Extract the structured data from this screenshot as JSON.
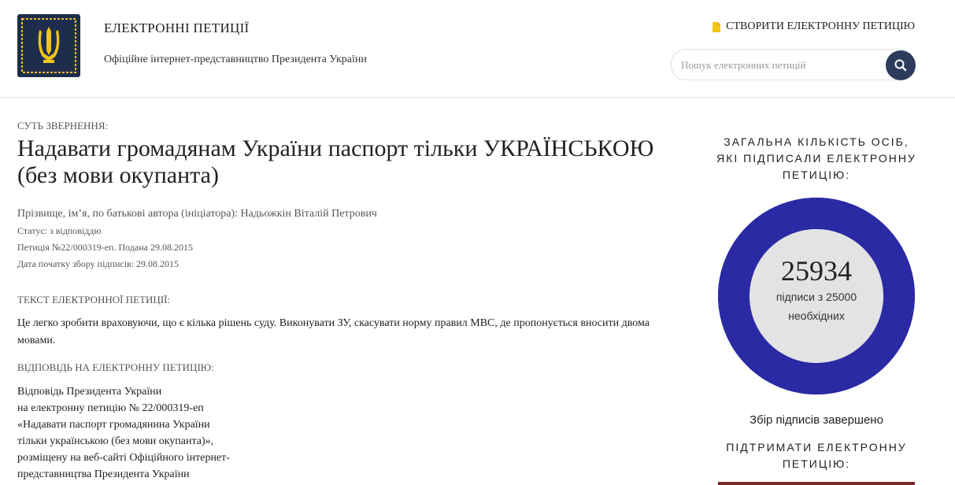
{
  "header": {
    "site_title": "ЕЛЕКТРОННІ ПЕТИЦІЇ",
    "site_subtitle": "Офіційне інтернет-представництво Президента України",
    "create_label": "СТВОРИТИ ЕЛЕКТРОННУ ПЕТИЦІЮ",
    "search_placeholder": "Пошук електронних петицій",
    "logo_icon": "trident-emblem-icon",
    "brand_color": "#1f2d4d",
    "accent_color": "#f0c419"
  },
  "petition": {
    "essence_label": "СУТЬ ЗВЕРНЕННЯ:",
    "title": "Надавати громадянам України паспорт тільки УКРАЇНСЬКОЮ (без мови окупанта)",
    "author": "Прізвище, ім’я, по батькові автора (ініціатора): Надьожкін Віталій Петрович",
    "status": "Статус: з відповіддю",
    "number": "Петиція №22/000319-еп. Подана 29.08.2015",
    "start_date": "Дата початку збору підписів: 29.08.2015",
    "text_label": "ТЕКСТ ЕЛЕКТРОННОЇ ПЕТИЦІЇ:",
    "text": "Це легко зробити враховуючи, що є кілька рішень суду. Виконувати ЗУ, скасувати норму правил МВС, де пропонується вносити двома мовами.",
    "answer_label": "ВІДПОВІДЬ НА ЕЛЕКТРОННУ ПЕТИЦІЮ:",
    "answer_lines": [
      "Відповідь Президента України",
      "на електронну петицію № 22/000319-еп",
      "«Надавати паспорт громадянина України",
      "тільки українською (без мови окупанта)»,",
      "розміщену на веб-сайті Офіційного інтернет-",
      "представництва Президента України"
    ]
  },
  "sidebar": {
    "total_label": "ЗАГАЛЬНА КІЛЬКІСТЬ ОСІБ, ЯКІ ПІДПИСАЛИ ЕЛЕКТРОННУ ПЕТИЦІЮ:",
    "count": "25934",
    "count_sub": "підписи з 25000 необхідних",
    "progress_fraction": 1.0,
    "ring_color": "#2a2aa5",
    "inner_color": "#e3e3e3",
    "done_text": "Збір підписів завершено",
    "support_label": "ПІДТРИМАТИ ЕЛЕКТРОННУ ПЕТИЦІЮ:"
  }
}
